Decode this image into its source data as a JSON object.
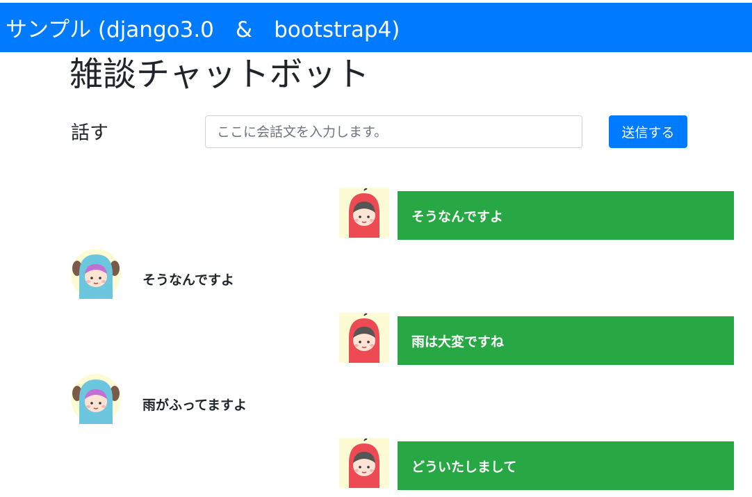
{
  "navbar": {
    "brand": "サンプル (django3.0　&　bootstrap4)",
    "color": "#007bff"
  },
  "page": {
    "title": "雑談チャットボット"
  },
  "form": {
    "label": "話す",
    "placeholder": "ここに会話文を入力します。",
    "value": "",
    "submit_label": "送信する"
  },
  "chat": [
    {
      "speaker": "bot",
      "avatar_icon": "red-hood-girl-icon",
      "text": "そうなんですよ"
    },
    {
      "speaker": "user",
      "avatar_icon": "blue-dog-hood-girl-icon",
      "text": "そうなんですよ"
    },
    {
      "speaker": "bot",
      "avatar_icon": "red-hood-girl-icon",
      "text": "雨は大変ですね"
    },
    {
      "speaker": "user",
      "avatar_icon": "blue-dog-hood-girl-icon",
      "text": "雨がふってますよ"
    },
    {
      "speaker": "bot",
      "avatar_icon": "red-hood-girl-icon",
      "text": "どういたしまして"
    }
  ],
  "colors": {
    "bot_bubble": "#28a745",
    "primary": "#007bff"
  }
}
